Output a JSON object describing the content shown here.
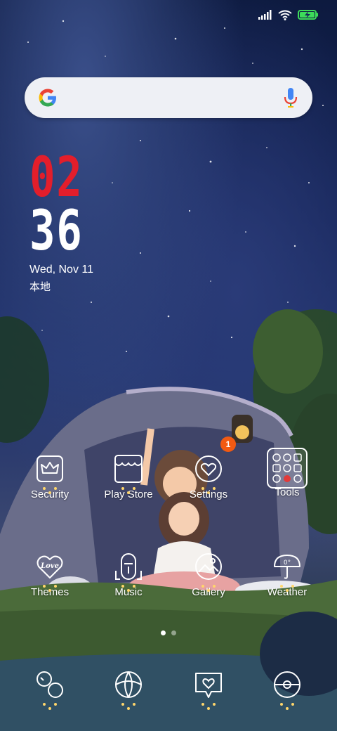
{
  "status_bar": {
    "signal_icon": "signal-bars-icon",
    "wifi_icon": "wifi-icon",
    "battery_icon": "battery-charging-icon",
    "battery_color": "#3ddc5a"
  },
  "search_bar": {
    "logo": "google-g-icon",
    "mic_icon": "microphone-icon"
  },
  "clock": {
    "hour": "02",
    "minute": "36",
    "date": "Wed, Nov 11",
    "location": "本地",
    "hour_color": "#e31e2b"
  },
  "home_apps": [
    {
      "label": "Security",
      "icon": "crown-shield-icon"
    },
    {
      "label": "Play Store",
      "icon": "store-awning-icon"
    },
    {
      "label": "Settings",
      "icon": "heart-circle-icon"
    },
    {
      "label": "Tools",
      "icon": "folder-grid-icon"
    },
    {
      "label": "Themes",
      "icon": "love-heart-icon",
      "icon_text": "Love"
    },
    {
      "label": "Music",
      "icon": "music-icon"
    },
    {
      "label": "Gallery",
      "icon": "gallery-icon"
    },
    {
      "label": "Weather",
      "icon": "umbrella-icon",
      "icon_text": "0°"
    }
  ],
  "notification_badge": {
    "count": "1",
    "color": "#f25a12"
  },
  "page_indicator": {
    "pages": 2,
    "active": 1
  },
  "dock_apps": [
    {
      "icon": "phone-icon"
    },
    {
      "icon": "browser-icon"
    },
    {
      "icon": "messages-icon"
    },
    {
      "icon": "camera-icon"
    }
  ]
}
